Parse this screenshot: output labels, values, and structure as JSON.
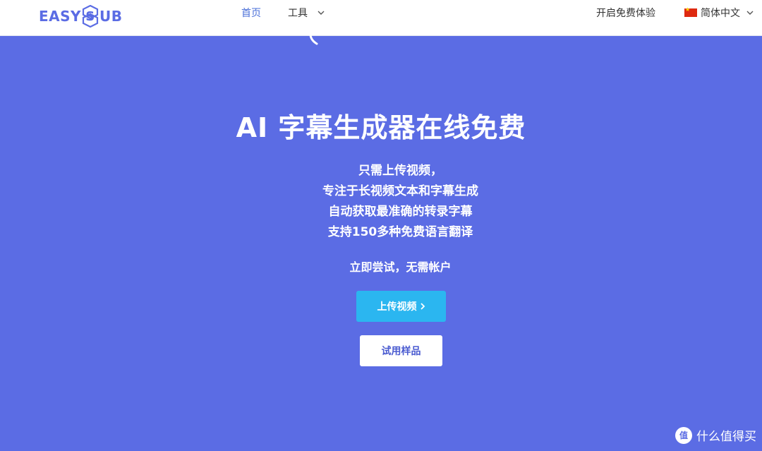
{
  "header": {
    "logo_left": "EASY",
    "logo_mid": "S",
    "logo_right": "UB",
    "nav_home": "首页",
    "nav_tools": "工具",
    "nav_trial": "开启免费体验",
    "nav_lang": "简体中文"
  },
  "hero": {
    "title": "AI 字幕生成器在线免费",
    "lines": [
      "只需上传视频，",
      "专注于长视频文本和字幕生成",
      "自动获取最准确的转录字幕",
      "支持150多种免费语言翻译"
    ],
    "try_text": "立即尝试，无需帐户",
    "upload_button": "上传视频",
    "sample_button": "试用样品"
  },
  "watermark": {
    "badge": "值",
    "text": "什么值得买"
  },
  "colors": {
    "brand": "#5b6ce4",
    "upload_button": "#2bb6f0",
    "nav_active": "#4a6fd8"
  },
  "icons": [
    "easysub-logo-icon",
    "chevron-down-icon",
    "china-flag-icon",
    "chevron-right-icon"
  ]
}
